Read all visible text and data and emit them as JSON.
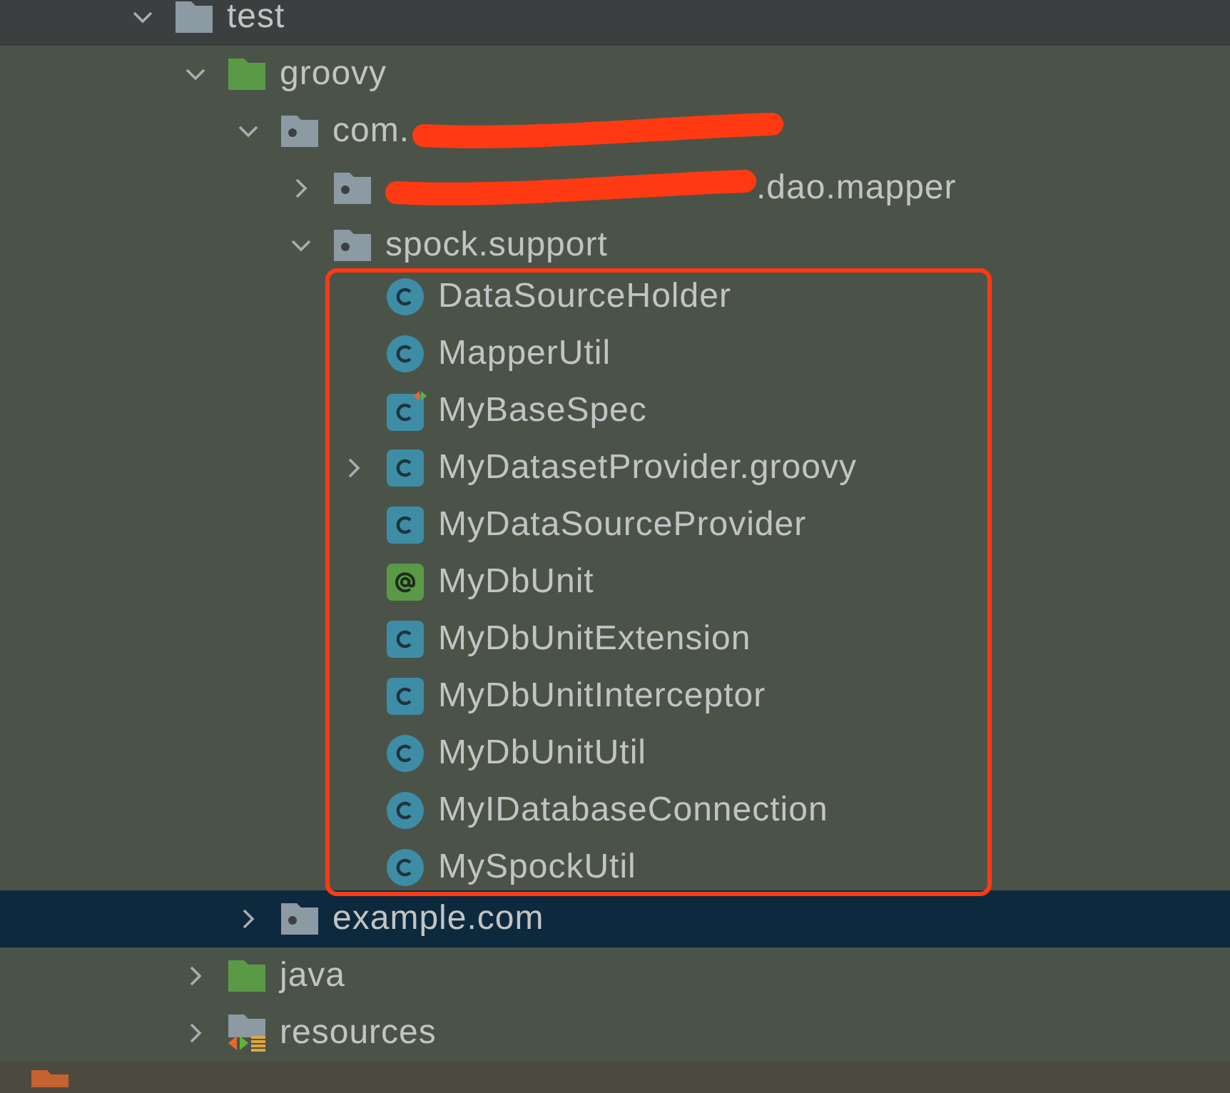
{
  "tree": [
    {
      "name": "test",
      "kind": "folder",
      "expanded": true,
      "selected": false,
      "children": [
        {
          "name": "groovy",
          "kind": "source-folder",
          "expanded": true,
          "selected": false,
          "children": [
            {
              "name": "com.",
              "kind": "package",
              "expanded": true,
              "selected": false,
              "redacted_end": true,
              "children": [
                {
                  "name": ".dao.mapper",
                  "kind": "package",
                  "expanded": false,
                  "selected": false,
                  "redacted_start": true
                },
                {
                  "name": "spock.support",
                  "kind": "package",
                  "expanded": true,
                  "selected": false,
                  "framed": true,
                  "children": [
                    {
                      "name": "DataSourceHolder",
                      "kind": "class",
                      "selected": false
                    },
                    {
                      "name": "MapperUtil",
                      "kind": "class",
                      "selected": false
                    },
                    {
                      "name": "MyBaseSpec",
                      "kind": "spec",
                      "selected": false
                    },
                    {
                      "name": "MyDatasetProvider.groovy",
                      "kind": "class-file",
                      "expanded": false,
                      "selected": false
                    },
                    {
                      "name": "MyDataSourceProvider",
                      "kind": "class-file",
                      "selected": false
                    },
                    {
                      "name": "MyDbUnit",
                      "kind": "annotation",
                      "selected": false
                    },
                    {
                      "name": "MyDbUnitExtension",
                      "kind": "class-file",
                      "selected": false
                    },
                    {
                      "name": "MyDbUnitInterceptor",
                      "kind": "class-file",
                      "selected": false
                    },
                    {
                      "name": "MyDbUnitUtil",
                      "kind": "class",
                      "selected": false
                    },
                    {
                      "name": "MyIDatabaseConnection",
                      "kind": "class",
                      "selected": false
                    },
                    {
                      "name": "MySpockUtil",
                      "kind": "class",
                      "selected": false
                    }
                  ]
                }
              ]
            },
            {
              "name": "example.com",
              "kind": "package",
              "expanded": false,
              "selected": true
            }
          ]
        },
        {
          "name": "java",
          "kind": "source-folder",
          "expanded": false,
          "selected": false
        },
        {
          "name": "resources",
          "kind": "resources-folder",
          "expanded": false,
          "selected": false
        }
      ]
    }
  ],
  "bottom_row": {
    "kind": "excluded-folder"
  }
}
